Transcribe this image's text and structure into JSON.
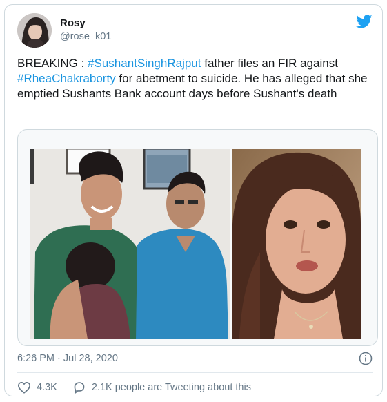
{
  "author": {
    "display_name": "Rosy",
    "handle": "@rose_k01"
  },
  "tweet": {
    "text_parts": [
      {
        "text": "BREAKING : ",
        "type": "text"
      },
      {
        "text": "#SushantSinghRajput",
        "type": "hashtag"
      },
      {
        "text": " father files an FIR against ",
        "type": "text"
      },
      {
        "text": "#RheaChakraborty",
        "type": "hashtag"
      },
      {
        "text": " for abetment to suicide. He has alleged that she emptied Sushants Bank account days before Sushant's death",
        "type": "text"
      }
    ]
  },
  "timestamp": "6:26 PM · Jul 28, 2020",
  "stats": {
    "likes": "4.3K",
    "replies_label": "2.1K people are Tweeting about this"
  },
  "icons": {
    "brand": "twitter-bird-icon",
    "like": "heart-icon",
    "reply": "speech-bubble-icon",
    "info": "info-icon"
  },
  "colors": {
    "accent": "#1da1f2",
    "hashtag": "#1b95e0",
    "muted": "#657786",
    "border": "#cfd9de"
  }
}
